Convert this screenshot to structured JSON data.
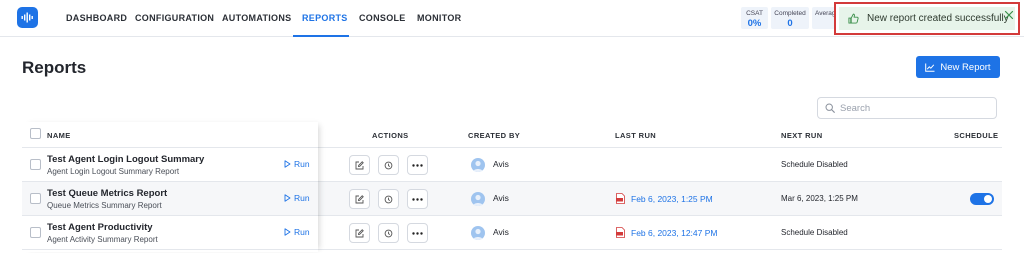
{
  "nav": {
    "items": [
      "DASHBOARD",
      "CONFIGURATION",
      "AUTOMATIONS",
      "REPORTS",
      "CONSOLE",
      "MONITOR"
    ],
    "active": "REPORTS"
  },
  "stats": [
    {
      "label": "CSAT",
      "value": "0%"
    },
    {
      "label": "Completed",
      "value": "0"
    },
    {
      "label": "Averag",
      "value": ""
    }
  ],
  "toast": {
    "message": "New report created successfully",
    "icon": "thumbs-up-icon",
    "background": "#e7f4ea",
    "highlight_border": "#d33a3a"
  },
  "page": {
    "title": "Reports",
    "new_button_label": "New Report"
  },
  "search": {
    "placeholder": "Search",
    "value": ""
  },
  "table": {
    "headers": {
      "name": "NAME",
      "actions": "ACTIONS",
      "created_by": "CREATED BY",
      "last_run": "LAST RUN",
      "next_run": "NEXT RUN",
      "schedule": "SCHEDULE"
    },
    "run_label": "Run",
    "rows": [
      {
        "name": "Test Agent Login Logout Summary",
        "description": "Agent Login Logout Summary Report",
        "created_by": "Avis",
        "last_run": "",
        "next_run": "Schedule Disabled",
        "schedule_enabled": false
      },
      {
        "name": "Test Queue Metrics Report",
        "description": "Queue Metrics Summary Report",
        "created_by": "Avis",
        "last_run": "Feb 6, 2023, 1:25 PM",
        "next_run": "Mar 6, 2023, 1:25 PM",
        "schedule_enabled": true
      },
      {
        "name": "Test Agent Productivity",
        "description": "Agent Activity Summary Report",
        "created_by": "Avis",
        "last_run": "Feb 6, 2023, 12:47 PM",
        "next_run": "Schedule Disabled",
        "schedule_enabled": false
      }
    ]
  },
  "colors": {
    "accent": "#1e73e6",
    "pdf_icon": "#d33a3a"
  }
}
